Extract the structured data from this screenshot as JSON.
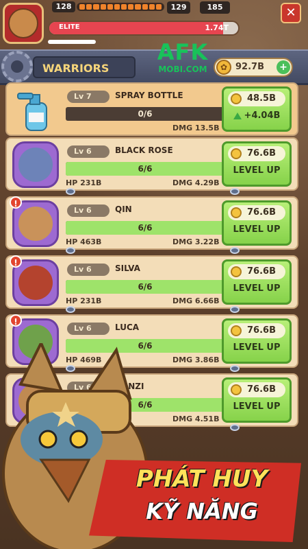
{
  "hud": {
    "player_level": "128",
    "stat_1": "129",
    "stat_2": "185",
    "close_label": "✕",
    "elite_label": "ELITE",
    "elite_value": "1.74T",
    "elite_fill": 0.92
  },
  "header": {
    "tab_title": "WARRIORS",
    "logo_top": "AFK",
    "logo_bottom": "MOBI.COM",
    "currency_value": "92.7B",
    "plus_label": "+"
  },
  "item": {
    "level": "Lv 7",
    "name": "SPRAY BOTTLE",
    "progress": "0/6",
    "progress_fill": 0,
    "dmg": "DMG 13.5B",
    "cost": "48.5B",
    "gain": "+4.04B"
  },
  "warriors": [
    {
      "level": "Lv 6",
      "name": "BLACK ROSE",
      "progress": "6/6",
      "progress_fill": 1,
      "hp": "HP 231B",
      "dmg": "DMG 4.29B",
      "cost": "76.6B",
      "action": "LEVEL UP",
      "alert": false,
      "color": "#6d83b8"
    },
    {
      "level": "Lv 6",
      "name": "QIN",
      "progress": "6/6",
      "progress_fill": 1,
      "hp": "HP 463B",
      "dmg": "DMG 3.22B",
      "cost": "76.6B",
      "action": "LEVEL UP",
      "alert": true,
      "color": "#c9925a"
    },
    {
      "level": "Lv 6",
      "name": "SILVA",
      "progress": "6/6",
      "progress_fill": 1,
      "hp": "HP 231B",
      "dmg": "DMG 6.66B",
      "cost": "76.6B",
      "action": "LEVEL UP",
      "alert": true,
      "color": "#b4432e"
    },
    {
      "level": "Lv 6",
      "name": "LUCA",
      "progress": "6/6",
      "progress_fill": 1,
      "hp": "HP 469B",
      "dmg": "DMG 3.86B",
      "cost": "76.6B",
      "action": "LEVEL UP",
      "alert": true,
      "color": "#6fa14b"
    },
    {
      "level": "Lv 6",
      "name": "DANZI",
      "progress": "6/6",
      "progress_fill": 1,
      "hp": "",
      "dmg": "DMG 4.51B",
      "cost": "76.6B",
      "action": "LEVEL UP",
      "alert": false,
      "color": "#c08a52"
    }
  ],
  "caption": {
    "line1": "PHÁT HUY",
    "line2": "KỸ NĂNG"
  }
}
